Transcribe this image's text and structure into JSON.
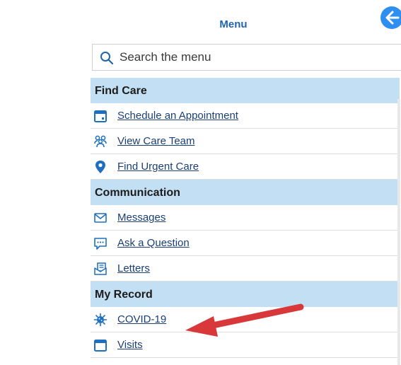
{
  "menu": {
    "title": "Menu",
    "back_button_label": "Back"
  },
  "search": {
    "placeholder": "Search the menu",
    "value": ""
  },
  "sections": [
    {
      "title": "Find Care",
      "items": [
        {
          "label": "Schedule an Appointment",
          "icon": "calendar-icon"
        },
        {
          "label": "View Care Team",
          "icon": "care-team-icon"
        },
        {
          "label": "Find Urgent Care",
          "icon": "map-pin-icon"
        }
      ]
    },
    {
      "title": "Communication",
      "items": [
        {
          "label": "Messages",
          "icon": "envelope-icon"
        },
        {
          "label": "Ask a Question",
          "icon": "chat-bubble-icon"
        },
        {
          "label": "Letters",
          "icon": "letter-icon"
        }
      ]
    },
    {
      "title": "My Record",
      "items": [
        {
          "label": "COVID-19",
          "icon": "virus-icon"
        },
        {
          "label": "Visits",
          "icon": "calendar-icon"
        }
      ]
    }
  ],
  "colors": {
    "accent": "#1f64ad",
    "back_button": "#2f8ff0",
    "section_background": "#c2dff3",
    "link_text": "#1b3f73",
    "annotation_arrow": "#d9383a"
  }
}
